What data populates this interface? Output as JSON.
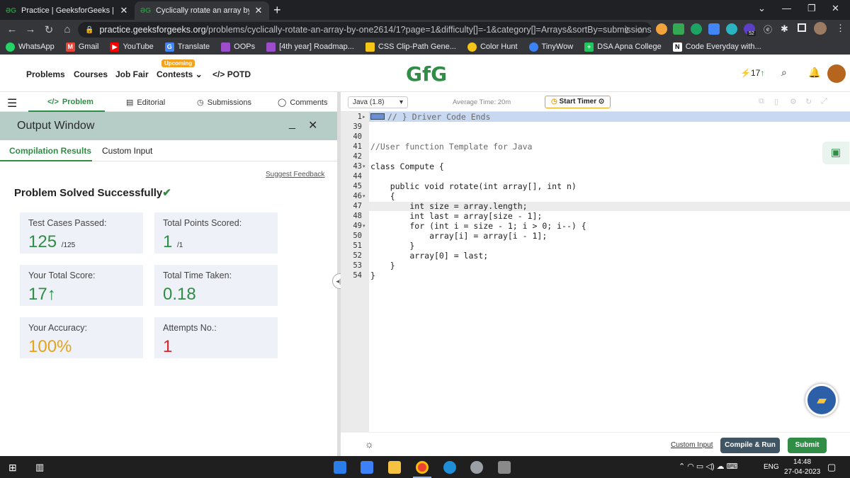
{
  "browser": {
    "tabs": [
      {
        "title": "Practice | GeeksforGeeks | A com",
        "favicon": "gfg-icon"
      },
      {
        "title": "Cyclically rotate an array by one",
        "favicon": "gfg-icon"
      }
    ],
    "url_host": "practice.geeksforgeeks.org",
    "url_path": "/problems/cyclically-rotate-an-array-by-one2614/1?page=1&difficulty[]=-1&category[]=Arrays&sortBy=submissions",
    "extension_badge": "52",
    "bookmarks": [
      "WhatsApp",
      "Gmail",
      "YouTube",
      "Translate",
      "OOPs",
      "[4th year] Roadmap...",
      "CSS Clip-Path Gene...",
      "Color Hunt",
      "TinyWow",
      "DSA Apna College",
      "Code Everyday with..."
    ]
  },
  "site": {
    "nav": [
      "Problems",
      "Courses",
      "Job Fair",
      "Contests",
      "POTD"
    ],
    "upcoming_badge": "Upcoming",
    "logo": "GfG",
    "streak": "17",
    "accent": "#2f8d46"
  },
  "problem_tabs": [
    "Problem",
    "Editorial",
    "Submissions",
    "Comments"
  ],
  "output": {
    "title": "Output Window",
    "tabs": [
      "Compilation Results",
      "Custom Input"
    ],
    "feedback": "Suggest Feedback",
    "status": "Problem Solved Successfully",
    "cards": [
      {
        "label": "Test Cases Passed:",
        "value": "125",
        "sub": "/125",
        "color": "#2f8d46"
      },
      {
        "label": "Total Points Scored:",
        "value": "1",
        "sub": "/1",
        "color": "#2f8d46"
      },
      {
        "label": "Your Total Score:",
        "value": "17",
        "sub": "",
        "color": "#2f8d46"
      },
      {
        "label": "Total Time Taken:",
        "value": "0.18",
        "sub": "",
        "color": "#2f8d46"
      },
      {
        "label": "Your Accuracy:",
        "value": "100%",
        "sub": "",
        "color": "#e8a317"
      },
      {
        "label": "Attempts No.:",
        "value": "1",
        "sub": "",
        "color": "#d9262a"
      }
    ]
  },
  "editor": {
    "language": "Java (1.8)",
    "avg_time": "Average Time: 20m",
    "timer_label": "Start Timer",
    "lines": [
      {
        "n": "1",
        "text": "// } Driver Code Ends"
      },
      {
        "n": "39",
        "text": ""
      },
      {
        "n": "40",
        "text": ""
      },
      {
        "n": "41",
        "text": "//User function Template for Java"
      },
      {
        "n": "42",
        "text": ""
      },
      {
        "n": "43",
        "text": "class Compute {"
      },
      {
        "n": "44",
        "text": ""
      },
      {
        "n": "45",
        "text": "    public void rotate(int array[], int n)"
      },
      {
        "n": "46",
        "text": "    {"
      },
      {
        "n": "47",
        "text": "        int size = array.length;"
      },
      {
        "n": "48",
        "text": "        int last = array[size - 1];"
      },
      {
        "n": "49",
        "text": "        for (int i = size - 1; i > 0; i--) {"
      },
      {
        "n": "50",
        "text": "            array[i] = array[i - 1];"
      },
      {
        "n": "51",
        "text": "        }"
      },
      {
        "n": "52",
        "text": "        array[0] = last;"
      },
      {
        "n": "53",
        "text": "    }"
      },
      {
        "n": "54",
        "text": "}"
      }
    ],
    "custom_input": "Custom Input",
    "compile_run": "Compile & Run",
    "submit": "Submit"
  },
  "taskbar": {
    "time": "14:48",
    "date": "27-04-2023",
    "lang": "ENG"
  }
}
